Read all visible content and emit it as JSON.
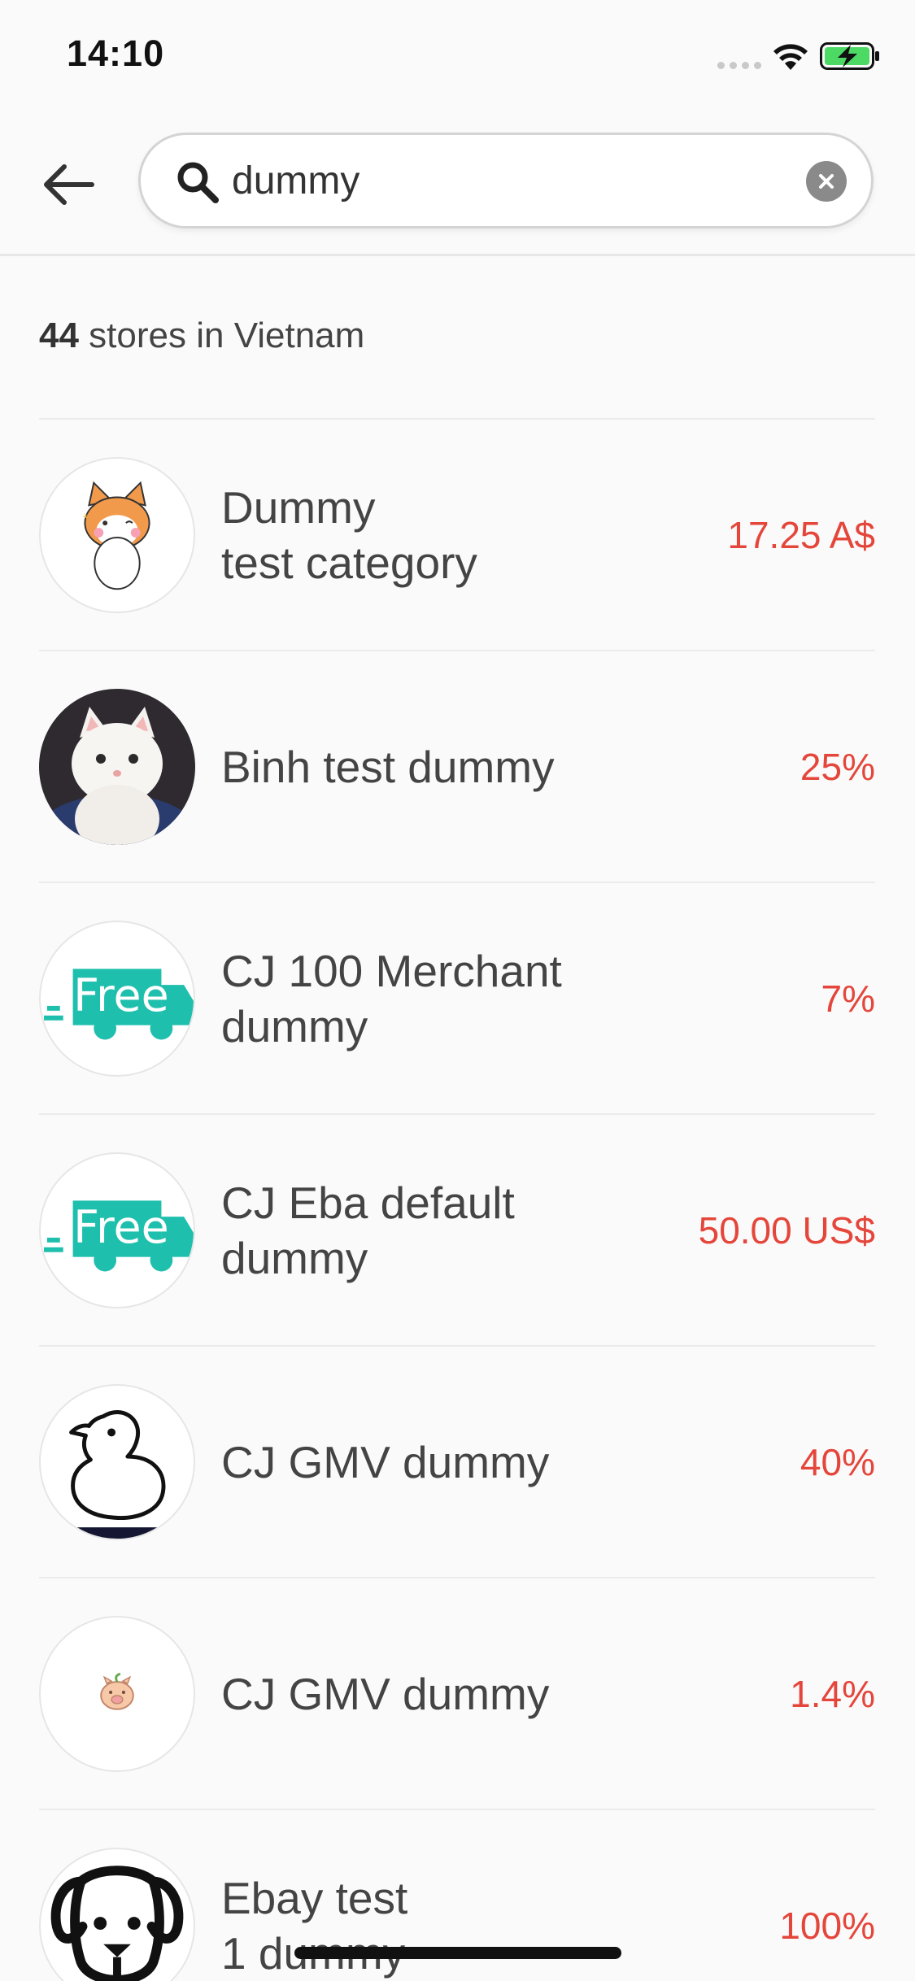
{
  "status_bar": {
    "time": "14:10"
  },
  "search": {
    "value": "dummy"
  },
  "results": {
    "count": "44",
    "suffix": " stores in Vietnam"
  },
  "stores": [
    {
      "name": "Dummy\ntest category",
      "cashback": "17.25 A$",
      "logo": "corgi-cartoon-logo"
    },
    {
      "name": "Binh test dummy",
      "cashback": "25%",
      "logo": "white-kitten-photo-logo"
    },
    {
      "name": "CJ 100 Merchant\ndummy",
      "cashback": "7%",
      "logo": "free-shipping-truck-logo",
      "logo_text": "Free"
    },
    {
      "name": "CJ Eba default\ndummy",
      "cashback": "50.00 US$",
      "logo": "free-shipping-truck-logo",
      "logo_text": "Free"
    },
    {
      "name": "CJ GMV dummy",
      "cashback": "40%",
      "logo": "duck-outline-logo"
    },
    {
      "name": "CJ GMV dummy",
      "cashback": "1.4%",
      "logo": "pig-logo"
    },
    {
      "name": "Ebay test\n1 dummy",
      "cashback": "100%",
      "logo": "dog-outline-logo"
    }
  ],
  "colors": {
    "cashback": "#e5463b",
    "accent_green": "#4cd964",
    "free_logo": "#1fbfae"
  }
}
